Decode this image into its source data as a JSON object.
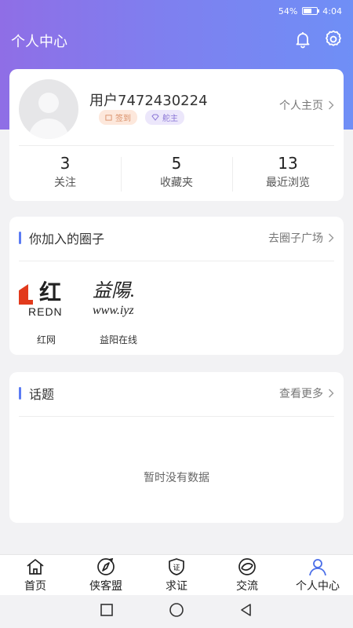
{
  "statusbar": {
    "battery": "54%",
    "time": "4:04"
  },
  "header": {
    "title": "个人中心"
  },
  "profile": {
    "username": "用户7472430224",
    "badges": [
      "签到",
      "舵主"
    ],
    "homepage_label": "个人主页",
    "stats": [
      {
        "value": "3",
        "label": "关注"
      },
      {
        "value": "5",
        "label": "收藏夹"
      },
      {
        "value": "13",
        "label": "最近浏览"
      }
    ]
  },
  "circles": {
    "title": "你加入的圈子",
    "more_label": "去圈子广场",
    "items": [
      {
        "name": "红网",
        "logo_text": "红",
        "logo_sub": "REDN"
      },
      {
        "name": "益阳在线",
        "logo_text": "益陽.",
        "logo_sub": "www.iyz"
      }
    ]
  },
  "topics": {
    "title": "话题",
    "more_label": "查看更多",
    "empty_text": "暂时没有数据"
  },
  "tabs": [
    {
      "label": "首页",
      "icon": "home-icon"
    },
    {
      "label": "侠客盟",
      "icon": "compass-icon"
    },
    {
      "label": "求证",
      "icon": "verify-shield-icon"
    },
    {
      "label": "交流",
      "icon": "chat-ring-icon"
    },
    {
      "label": "个人中心",
      "icon": "person-icon",
      "active": true
    }
  ],
  "colors": {
    "accent": "#5b7bf3",
    "hero_start": "#8f6ee6",
    "hero_end": "#6f8ff6",
    "redn": "#e23a1c"
  }
}
